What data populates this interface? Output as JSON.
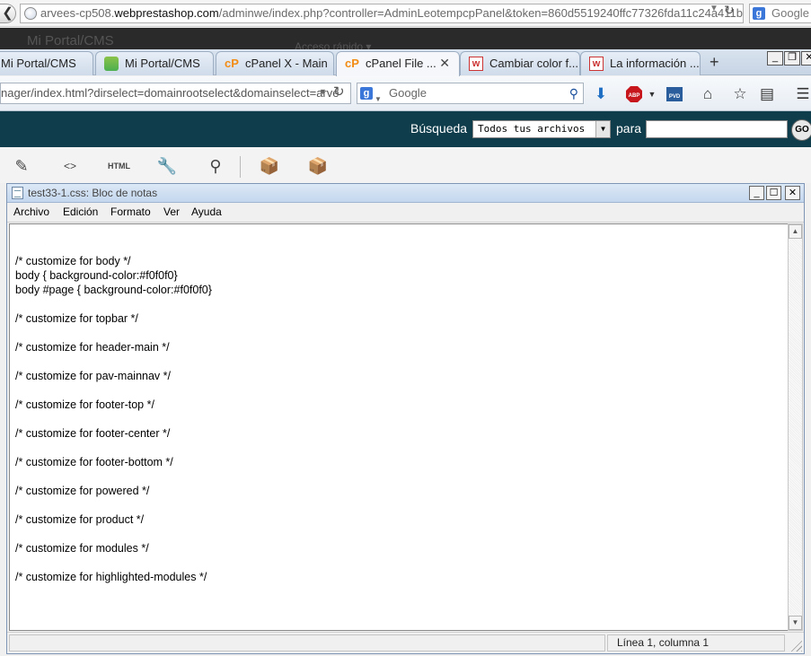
{
  "outer_browser": {
    "url_prefix": "arvees-cp508.",
    "url_host": "webprestashop.com",
    "url_rest": "/adminwe/index.php?controller=AdminLeotempcpPanel&token=860d5519240ffc77326fda11c24a411b",
    "search_text": "Google"
  },
  "background_page": {
    "title_text": "Mi Portal/CMS",
    "quick_access": "Acceso rápido ▾"
  },
  "tabs": [
    {
      "label": "Mi Portal/CMS",
      "icon": "none"
    },
    {
      "label": "Mi Portal/CMS",
      "icon": "portal-icon"
    },
    {
      "label": "cPanel X - Main",
      "icon": "cpanel-icon"
    },
    {
      "label": "cPanel File ...",
      "icon": "cpanel-icon",
      "active": true,
      "close": "✕"
    },
    {
      "label": "Cambiar color f...",
      "icon": "w-icon"
    },
    {
      "label": "La información ...",
      "icon": "w-icon"
    }
  ],
  "newtab_symbol": "+",
  "window_controls": {
    "minimize": "_",
    "restore": "❐",
    "close": "✕"
  },
  "navbar": {
    "url": "nager/index.html?dirselect=domainrootselect&domainselect=arve",
    "search_placeholder": "Google",
    "g_badge": "g"
  },
  "cpanel_bar": {
    "search_label": "Búsqueda",
    "select_value": "Todos tus archivos",
    "para_label": "para",
    "go_label": "GO"
  },
  "notepad": {
    "title": "test33-1.css: Bloc de notas",
    "menu": [
      "Archivo",
      "Edición",
      "Formato",
      "Ver",
      "Ayuda"
    ],
    "lines": [
      "",
      "/* customize for body */",
      "body { background-color:#f0f0f0}",
      "body #page { background-color:#f0f0f0}",
      "",
      "/* customize for topbar */",
      "",
      "/* customize for header-main */",
      "",
      "/* customize for pav-mainnav */",
      "",
      "/* customize for footer-top */",
      "",
      "/* customize for footer-center */",
      "",
      "/* customize for footer-bottom */",
      "",
      "/* customize for powered */",
      "",
      "/* customize for product */",
      "",
      "/* customize for modules */",
      "",
      "/* customize for highlighted-modules */"
    ],
    "status_position": "Línea 1, columna 1"
  },
  "colors": {
    "cpanel_bar_bg": "#0f3d4c",
    "tab_strip_bg": "#c7d4e4",
    "cpanel_orange": "#f28c14"
  }
}
